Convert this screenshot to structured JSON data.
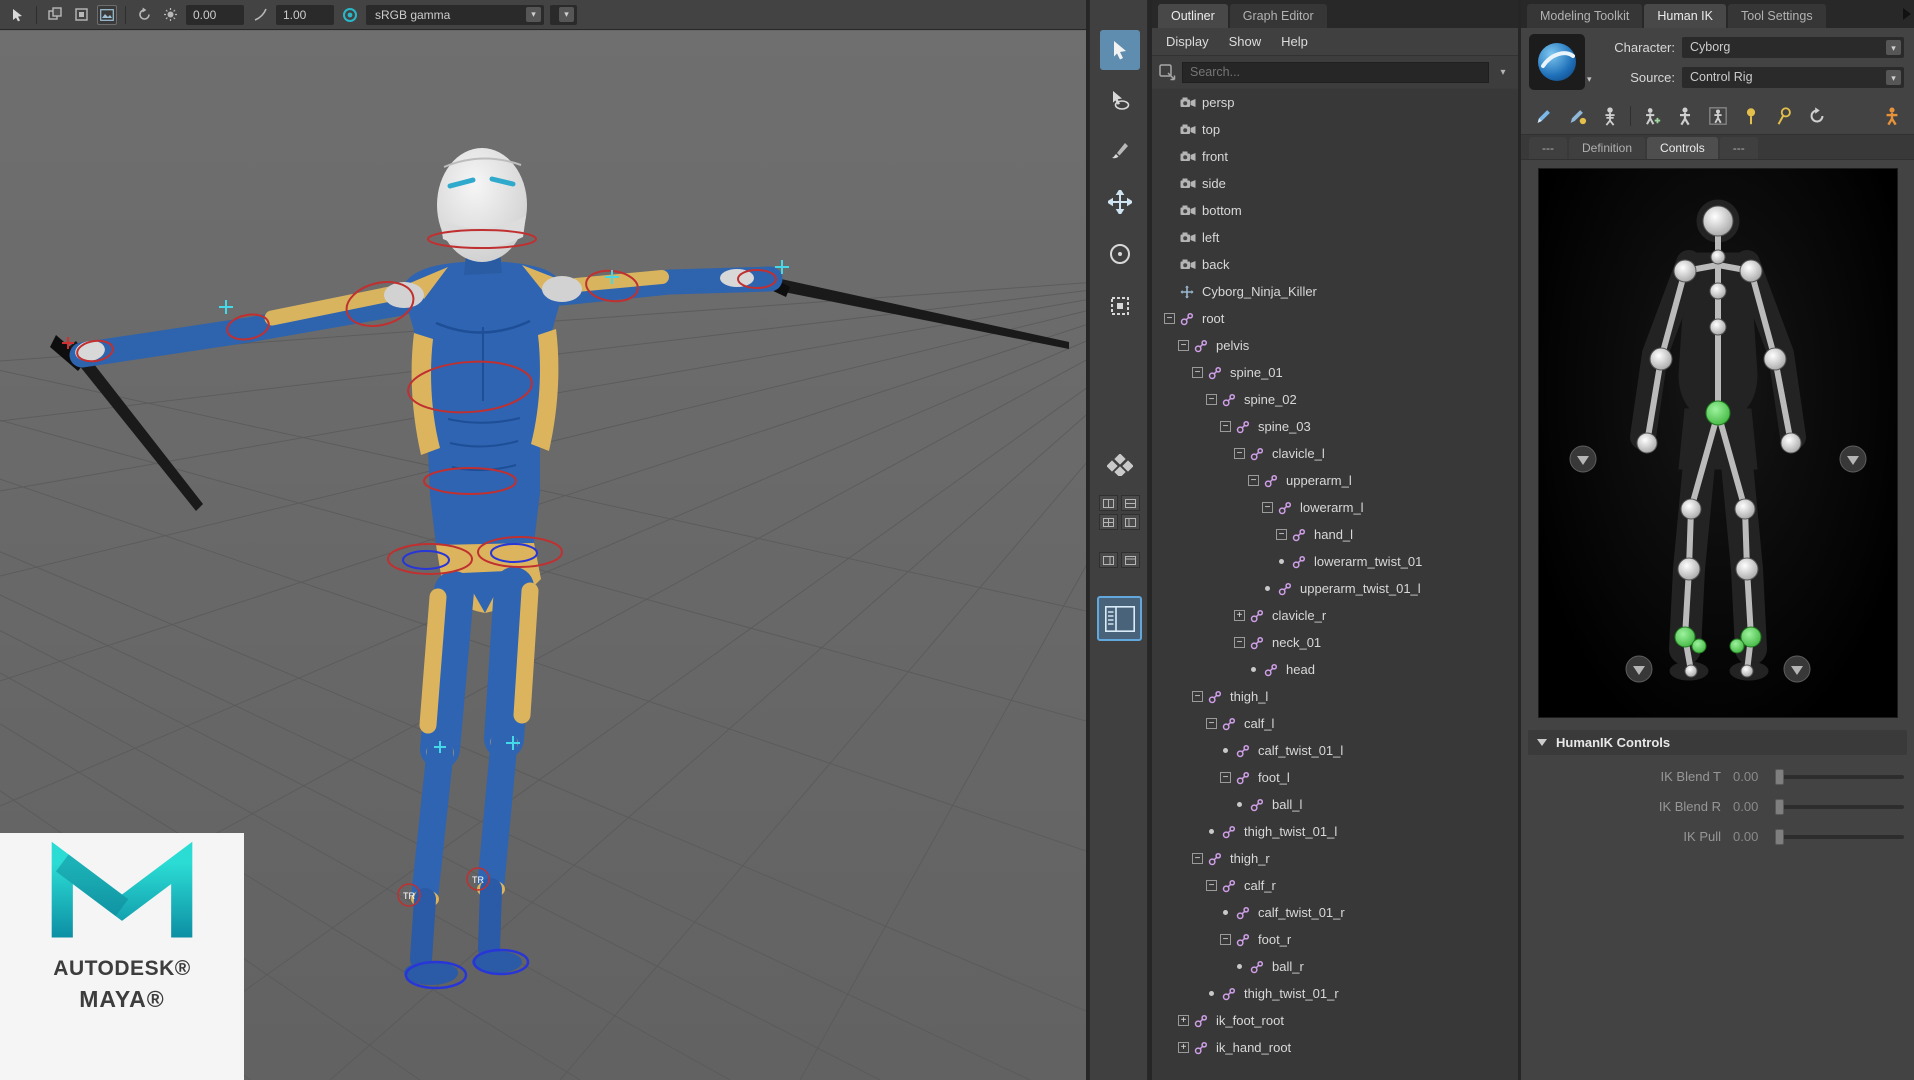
{
  "viewport": {
    "toolbar": {
      "exposure_value": "0.00",
      "gamma_value": "1.00",
      "view_transform": "sRGB gamma",
      "icons": [
        "cursor-icon",
        "duplicate-icon",
        "isolate-icon",
        "image-plane-icon",
        "refresh-icon",
        "exposure-icon",
        "gamma-icon",
        "color-managed-toggle-icon",
        "chevron-down-icon"
      ]
    },
    "rig_labels": {
      "tr": "TR"
    },
    "watermark": {
      "brand": "AUTODESK®",
      "product": "MAYA®"
    }
  },
  "toolbox": {
    "tools": [
      "select-tool",
      "lasso-select-tool",
      "paint-select-tool",
      "move-tool",
      "rotate-tool",
      "scale-tool"
    ],
    "active_tool": "select-tool",
    "layouts": [
      "saved-layouts",
      "pane-layout-a",
      "pane-layout-b",
      "pane-layout-c",
      "pane-layout-d",
      "pane-layout-e",
      "pane-layout-f",
      "persp-outliner-layout"
    ],
    "active_layout": "persp-outliner-layout"
  },
  "outliner": {
    "tabs": [
      {
        "label": "Outliner"
      },
      {
        "label": "Graph Editor"
      }
    ],
    "menus": [
      "Display",
      "Show",
      "Help"
    ],
    "search_placeholder": "Search...",
    "toggle_glyphs": {
      "minus": "−",
      "plus": "+"
    },
    "tree": [
      {
        "label": "persp",
        "level": 0,
        "toggle": "none",
        "icon": "camera"
      },
      {
        "label": "top",
        "level": 0,
        "toggle": "none",
        "icon": "camera"
      },
      {
        "label": "front",
        "level": 0,
        "toggle": "none",
        "icon": "camera"
      },
      {
        "label": "side",
        "level": 0,
        "toggle": "none",
        "icon": "camera"
      },
      {
        "label": "bottom",
        "level": 0,
        "toggle": "none",
        "icon": "camera"
      },
      {
        "label": "left",
        "level": 0,
        "toggle": "none",
        "icon": "camera"
      },
      {
        "label": "back",
        "level": 0,
        "toggle": "none",
        "icon": "camera"
      },
      {
        "label": "Cyborg_Ninja_Killer",
        "level": 0,
        "toggle": "none",
        "icon": "transform"
      },
      {
        "label": "root",
        "level": 0,
        "toggle": "minus",
        "icon": "joint"
      },
      {
        "label": "pelvis",
        "level": 1,
        "toggle": "minus",
        "icon": "joint"
      },
      {
        "label": "spine_01",
        "level": 2,
        "toggle": "minus",
        "icon": "joint"
      },
      {
        "label": "spine_02",
        "level": 3,
        "toggle": "minus",
        "icon": "joint"
      },
      {
        "label": "spine_03",
        "level": 4,
        "toggle": "minus",
        "icon": "joint"
      },
      {
        "label": "clavicle_l",
        "level": 5,
        "toggle": "minus",
        "icon": "joint"
      },
      {
        "label": "upperarm_l",
        "level": 6,
        "toggle": "minus",
        "icon": "joint"
      },
      {
        "label": "lowerarm_l",
        "level": 7,
        "toggle": "minus",
        "icon": "joint"
      },
      {
        "label": "hand_l",
        "level": 8,
        "toggle": "minus",
        "icon": "joint"
      },
      {
        "label": "lowerarm_twist_01",
        "level": 8,
        "toggle": "leaf",
        "icon": "joint"
      },
      {
        "label": "upperarm_twist_01_l",
        "level": 7,
        "toggle": "leaf",
        "icon": "joint"
      },
      {
        "label": "clavicle_r",
        "level": 5,
        "toggle": "plus",
        "icon": "joint"
      },
      {
        "label": "neck_01",
        "level": 5,
        "toggle": "minus",
        "icon": "joint"
      },
      {
        "label": "head",
        "level": 6,
        "toggle": "leaf",
        "icon": "joint"
      },
      {
        "label": "thigh_l",
        "level": 2,
        "toggle": "minus",
        "icon": "joint"
      },
      {
        "label": "calf_l",
        "level": 3,
        "toggle": "minus",
        "icon": "joint"
      },
      {
        "label": "calf_twist_01_l",
        "level": 4,
        "toggle": "leaf",
        "icon": "joint"
      },
      {
        "label": "foot_l",
        "level": 4,
        "toggle": "minus",
        "icon": "joint"
      },
      {
        "label": "ball_l",
        "level": 5,
        "toggle": "leaf",
        "icon": "joint"
      },
      {
        "label": "thigh_twist_01_l",
        "level": 3,
        "toggle": "leaf",
        "icon": "joint"
      },
      {
        "label": "thigh_r",
        "level": 2,
        "toggle": "minus",
        "icon": "joint"
      },
      {
        "label": "calf_r",
        "level": 3,
        "toggle": "minus",
        "icon": "joint"
      },
      {
        "label": "calf_twist_01_r",
        "level": 4,
        "toggle": "leaf",
        "icon": "joint"
      },
      {
        "label": "foot_r",
        "level": 4,
        "toggle": "minus",
        "icon": "joint"
      },
      {
        "label": "ball_r",
        "level": 5,
        "toggle": "leaf",
        "icon": "joint"
      },
      {
        "label": "thigh_twist_01_r",
        "level": 3,
        "toggle": "leaf",
        "icon": "joint"
      },
      {
        "label": "ik_foot_root",
        "level": 1,
        "toggle": "plus",
        "icon": "joint"
      },
      {
        "label": "ik_hand_root",
        "level": 1,
        "toggle": "plus",
        "icon": "joint"
      }
    ]
  },
  "hik": {
    "tabs": [
      {
        "label": "Modeling Toolkit"
      },
      {
        "label": "Human IK"
      },
      {
        "label": "Tool Settings"
      }
    ],
    "character_label": "Character:",
    "character_value": "Cyborg",
    "source_label": "Source:",
    "source_value": "Control Rig",
    "toolbar_icons": [
      "edit-definition-pencil-icon",
      "edit-controls-pencil-icon",
      "skeleton-icon",
      "figure-add-icon",
      "figure-icon",
      "figure-stance-icon",
      "pin-translate-icon",
      "pin-rotate-icon",
      "reset-pose-icon",
      "character-orange-icon"
    ],
    "subtabs": [
      {
        "label": "---"
      },
      {
        "label": "Definition"
      },
      {
        "label": "Controls"
      },
      {
        "label": "---"
      }
    ],
    "controls_header": "HumanIK Controls",
    "sliders": [
      {
        "label": "IK Blend T",
        "value": "0.00"
      },
      {
        "label": "IK Blend R",
        "value": "0.00"
      },
      {
        "label": "IK Pull",
        "value": "0.00"
      }
    ]
  },
  "colors": {
    "accent_blue": "#5ea7d8",
    "joint_green": "#43cf43",
    "maya_teal": "#1bbfbf",
    "control_red": "#c03030",
    "control_cyan": "#45d8e8"
  }
}
